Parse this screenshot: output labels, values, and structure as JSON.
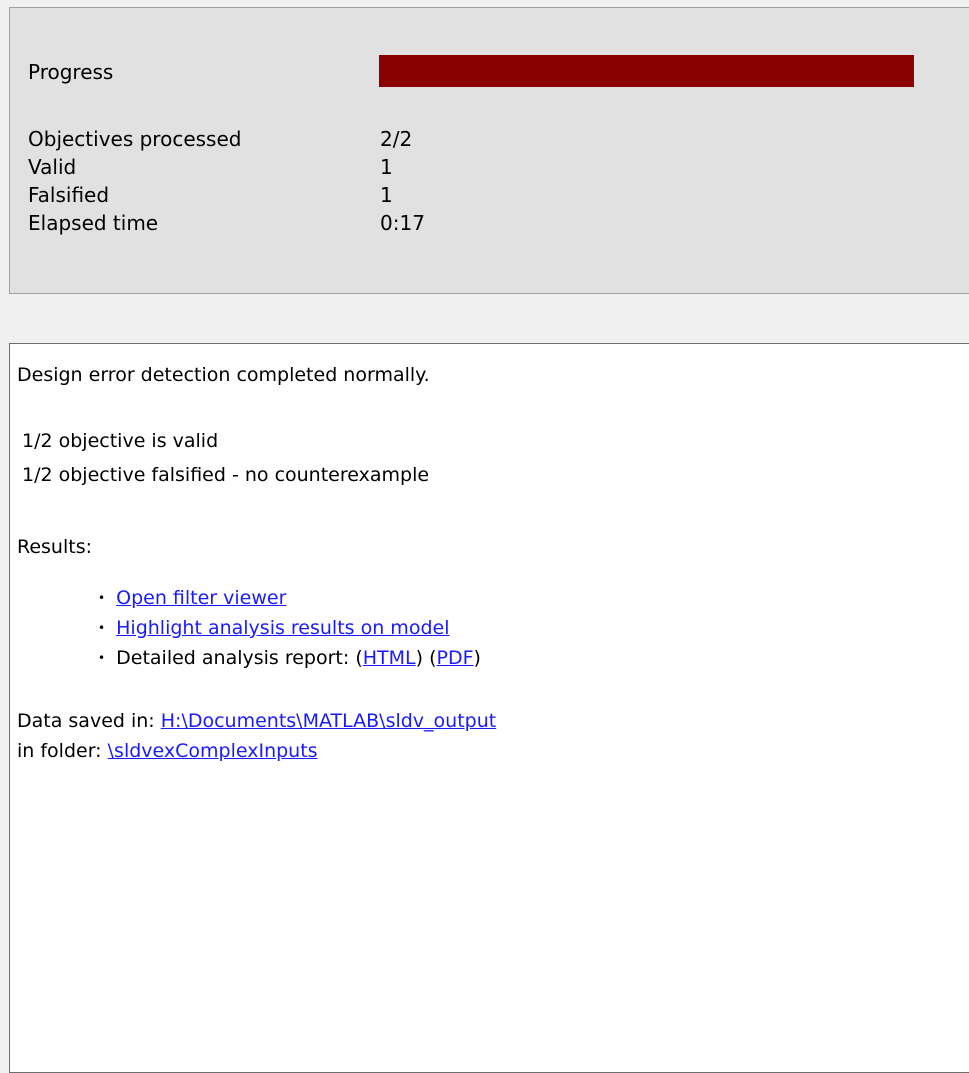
{
  "progress": {
    "label": "Progress",
    "fraction": 1.0,
    "color": "#8b0000"
  },
  "stats": [
    {
      "label": "Objectives processed",
      "value": "2/2"
    },
    {
      "label": "Valid",
      "value": "1"
    },
    {
      "label": "Falsified",
      "value": "1"
    },
    {
      "label": "Elapsed time",
      "value": "0:17"
    }
  ],
  "report": {
    "completion_message": "Design error detection completed normally.",
    "summary": [
      "1/2 objective is valid",
      "1/2 objective falsified - no counterexample"
    ],
    "results_heading": "Results:",
    "links": {
      "filter_viewer": "Open filter viewer",
      "highlight": "Highlight analysis results on model",
      "detailed_report_label": "Detailed analysis report:",
      "html": "HTML",
      "pdf": "PDF"
    },
    "data_saved_label": "Data saved in:",
    "data_saved_path": "H:\\Documents\\MATLAB\\sldv_output",
    "folder_label": "in folder:",
    "folder_path": "\\sldvexComplexInputs"
  },
  "colors": {
    "link": "#1a1aff",
    "panel_background": "#e1e1e1"
  }
}
